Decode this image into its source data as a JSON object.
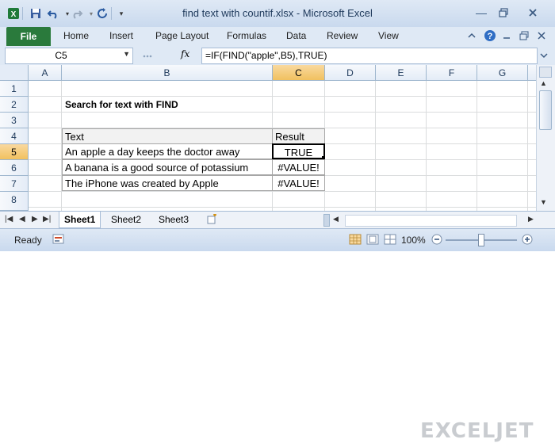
{
  "window": {
    "title": "find text with countif.xlsx - Microsoft Excel"
  },
  "ribbon": {
    "file_label": "File",
    "tabs": [
      "Home",
      "Insert",
      "Page Layout",
      "Formulas",
      "Data",
      "Review",
      "View"
    ]
  },
  "formula_bar": {
    "name_box": "C5",
    "fx_label": "fx",
    "formula": "=IF(FIND(\"apple\",B5),TRUE)"
  },
  "grid": {
    "columns": [
      "A",
      "B",
      "C",
      "D",
      "E",
      "F",
      "G"
    ],
    "rows": [
      "1",
      "2",
      "3",
      "4",
      "5",
      "6",
      "7",
      "8"
    ],
    "active_cell": "C5",
    "heading": "Search for text with FIND",
    "table_header": {
      "text": "Text",
      "result": "Result"
    },
    "table_rows": [
      {
        "text": "An apple a day keeps the doctor away",
        "result": "TRUE"
      },
      {
        "text": "A banana is a good source of potassium",
        "result": "#VALUE!"
      },
      {
        "text": "The iPhone was created by Apple",
        "result": "#VALUE!"
      }
    ]
  },
  "sheets": {
    "tabs": [
      "Sheet1",
      "Sheet2",
      "Sheet3"
    ],
    "active": "Sheet1"
  },
  "status": {
    "ready": "Ready",
    "zoom": "100%"
  },
  "watermark": "EXCELJET",
  "colors": {
    "file_tab": "#2a7a3c",
    "header_selected": "#f1c15f",
    "accent": "#1e395b"
  }
}
